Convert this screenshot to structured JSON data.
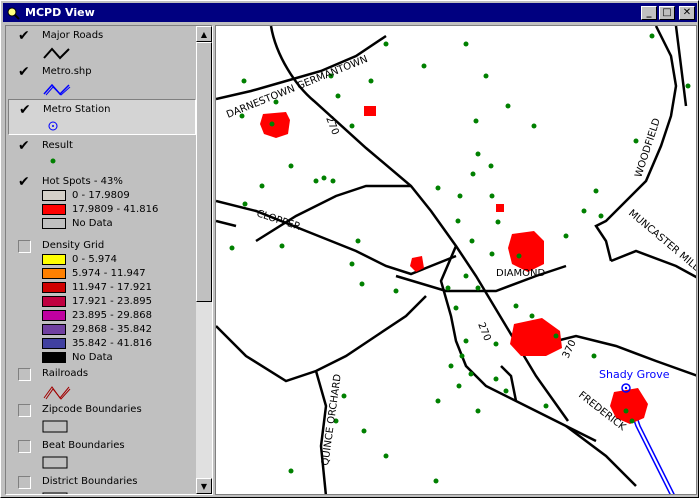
{
  "window": {
    "title": "MCPD View"
  },
  "legend": {
    "layers": [
      {
        "name": "Major Roads",
        "checked": true
      },
      {
        "name": "Metro.shp",
        "checked": true
      },
      {
        "name": "Metro Station",
        "checked": true
      },
      {
        "name": "Result",
        "checked": true
      },
      {
        "name": "Hot Spots - 43%",
        "checked": true,
        "classes": [
          {
            "label": "0 - 17.9809",
            "color": "#d4d0c8"
          },
          {
            "label": "17.9809 - 41.816",
            "color": "#ff0000"
          },
          {
            "label": "No Data",
            "color": "#c0c0c0"
          }
        ]
      },
      {
        "name": "Density Grid",
        "checked": false,
        "classes": [
          {
            "label": "0 - 5.974",
            "color": "#ffff00"
          },
          {
            "label": "5.974 - 11.947",
            "color": "#ff8000"
          },
          {
            "label": "11.947 - 17.921",
            "color": "#d00000"
          },
          {
            "label": "17.921 - 23.895",
            "color": "#c00040"
          },
          {
            "label": "23.895 - 29.868",
            "color": "#c000a0"
          },
          {
            "label": "29.868 - 35.842",
            "color": "#7040a0"
          },
          {
            "label": "35.842 - 41.816",
            "color": "#4040a0"
          },
          {
            "label": "No Data",
            "color": "#000000"
          }
        ]
      },
      {
        "name": "Railroads",
        "checked": false
      },
      {
        "name": "Zipcode Boundaries",
        "checked": false
      },
      {
        "name": "Beat Boundaries",
        "checked": false
      },
      {
        "name": "District Boundaries",
        "checked": false
      }
    ]
  },
  "map": {
    "road_labels": [
      "DARNESTOWN GERMANTOWN",
      "270",
      "WOODFIELD",
      "CLOPPER",
      "MUNCASTER MILL",
      "DIAMOND",
      "270",
      "370",
      "QUINCE ORCHARD",
      "FREDERICK"
    ],
    "station_label": "Shady Grove",
    "colors": {
      "hotspot": "#ff0000",
      "point": "#008000",
      "metro": "#0000ff",
      "road": "#000000"
    }
  }
}
